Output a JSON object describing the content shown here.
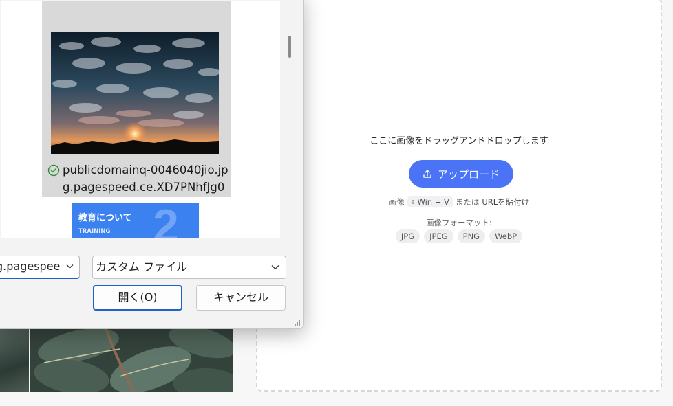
{
  "webpage": {
    "drop_text": "ここに画像をドラッグアンドドロップします",
    "upload_label": "アップロード",
    "paste_hint": {
      "prefix": "画像",
      "shortcut": "Win + V",
      "middle": "または",
      "url_paste": "URLを貼付け"
    },
    "format_label": "画像フォーマット:",
    "formats": [
      "JPG",
      "JPEG",
      "PNG",
      "WebP"
    ],
    "accent_color": "#4a74f5"
  },
  "dialog": {
    "files": {
      "selected": {
        "name": "publicdomainq-0046040jio.jpg.pagespeed.ce.XD7PNhfJg0",
        "status_icon": "check-circle-icon"
      },
      "next": {
        "title": "教育について",
        "subtitle": "TRAINING",
        "number": "2"
      }
    },
    "filename_value": "g.pagespee",
    "filetype_value": "カスタム ファイル",
    "open_label": "開く(O)",
    "cancel_label": "キャンセル",
    "focus_color": "#1f63c8"
  }
}
